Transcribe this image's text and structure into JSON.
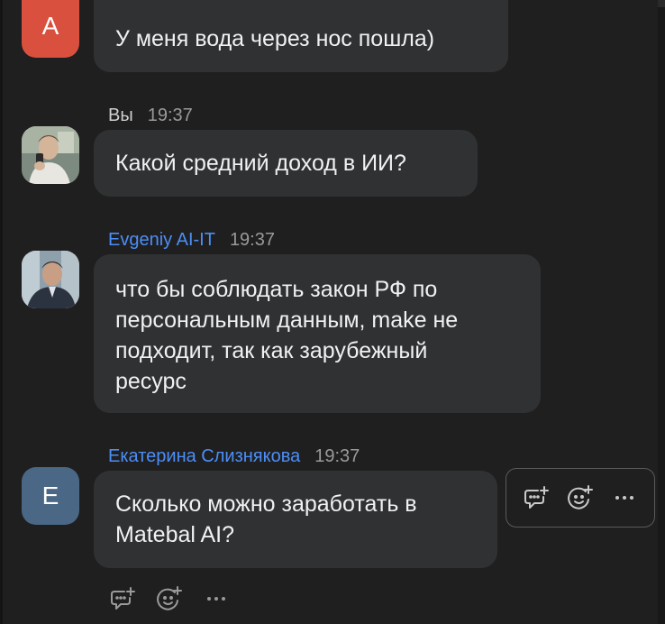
{
  "messages": [
    {
      "avatar_letter": "A",
      "avatar_color": "#d9503f",
      "text": "У меня вода через нос пошла)"
    },
    {
      "sender": "Вы",
      "time": "19:37",
      "sender_color": "#cfcfcf",
      "avatar_type": "photo",
      "text": "Какой средний доход в ИИ?"
    },
    {
      "sender": "Evgeniy AI-IT",
      "time": "19:37",
      "sender_color": "#4c8ef7",
      "avatar_type": "photo",
      "text": "что бы соблюдать закон РФ по\nперсональным данным, make не\nподходит, так как зарубежный\nресурс"
    },
    {
      "sender": "Екатерина Слизнякова",
      "time": "19:37",
      "sender_color": "#4c8ef7",
      "avatar_letter": "Е",
      "avatar_color": "#4a6785",
      "text": "Сколько можно заработать в\nMatebal AI?"
    }
  ],
  "actions": {
    "reply_icon": "comment-plus-icon",
    "react_icon": "emoji-plus-icon",
    "more_icon": "more-horizontal-icon"
  }
}
